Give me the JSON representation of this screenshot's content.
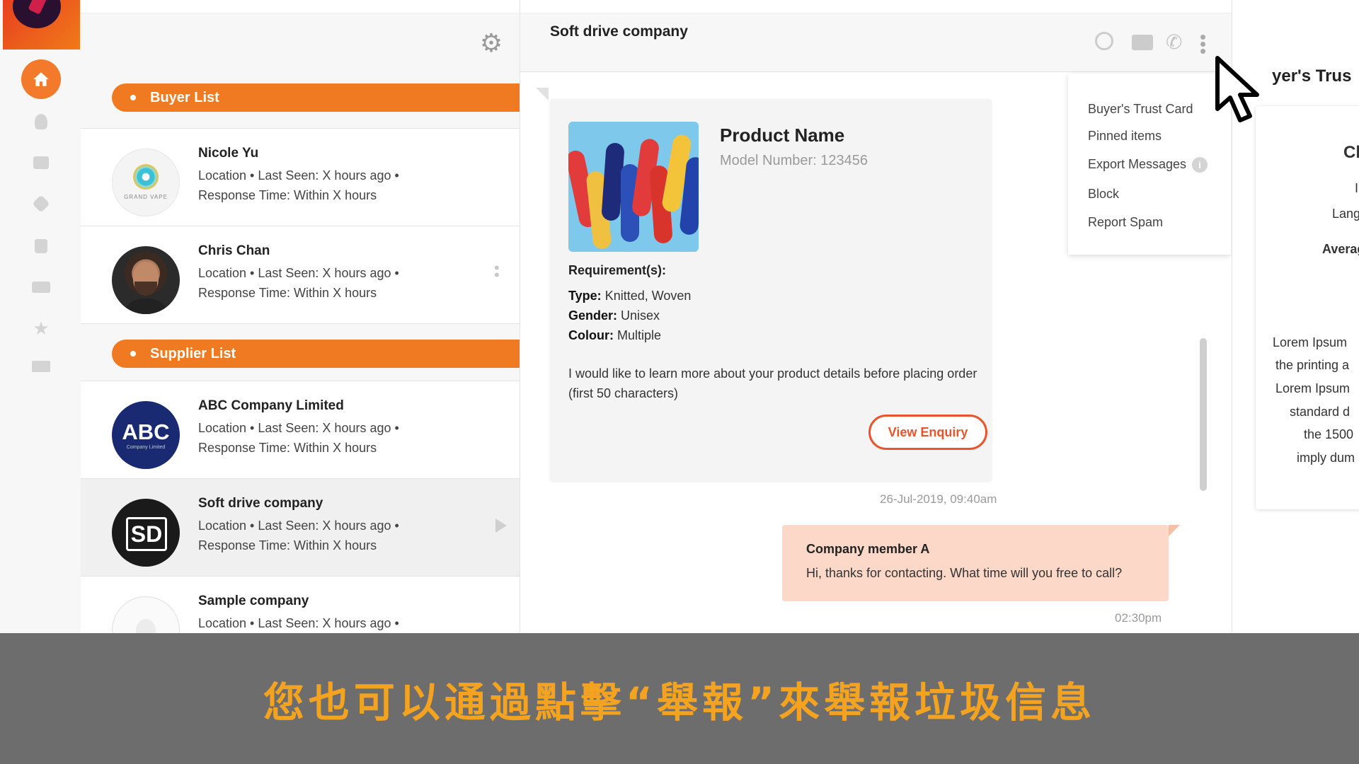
{
  "contacts": {
    "buyer_section": "Buyer List",
    "supplier_section": "Supplier List",
    "buyers": [
      {
        "name": "Nicole Yu",
        "line1": "Location  •  Last Seen: X hours ago  •",
        "line2": "Response Time: Within X hours",
        "avatar_text": "GRAND VAPE"
      },
      {
        "name": "Chris Chan",
        "line1": "Location  •  Last Seen: X hours ago  •",
        "line2": "Response Time: Within X hours"
      }
    ],
    "suppliers": [
      {
        "name": "ABC Company Limited",
        "line1": "Location  •  Last Seen: X hours ago  •",
        "line2": "Response Time: Within X hours",
        "avatar_big": "ABC",
        "avatar_small": "Company Limited"
      },
      {
        "name": "Soft drive company",
        "line1": "Location  •  Last Seen: X hours ago  •",
        "line2": "Response Time: Within X hours",
        "avatar_text": "SD"
      },
      {
        "name": "Sample company",
        "line1": "Location  •  Last Seen: X hours ago  •"
      }
    ]
  },
  "chat": {
    "title": "Soft drive company",
    "enquiry": {
      "product_name": "Product Name",
      "model_number": "Model Number: 123456",
      "requirements_heading": "Requirement(s):",
      "type_label": "Type:",
      "type_value": "Knitted, Woven",
      "gender_label": "Gender:",
      "gender_value": "Unisex",
      "colour_label": "Colour:",
      "colour_value": "Multiple",
      "message": "I would like to learn more about your product details before placing order (first 50 characters)",
      "button": "View Enquiry",
      "timestamp": "26-Jul-2019, 09:40am"
    },
    "reply": {
      "sender": "Company member A",
      "text": "Hi, thanks for contacting. What time will you free to call?",
      "timestamp": "02:30pm"
    }
  },
  "menu": {
    "items": [
      "Buyer's Trust Card",
      "Pinned items",
      "Export Messages",
      "Block",
      "Report Spam"
    ],
    "info": "i"
  },
  "trust_panel": {
    "title": "yer's Trus",
    "texts": [
      "Cl",
      "I",
      "Lang",
      "Averag",
      "Lorem Ipsum",
      "the printing a",
      "Lorem Ipsum",
      "standard d",
      "the 1500",
      "imply dum"
    ]
  },
  "caption": "您也可以通過點擊“舉報”來舉報垃圾信息",
  "colors": {
    "accent_orange": "#f07a22",
    "button_red": "#e9542a",
    "reply_bubble": "#fbd8c7",
    "caption_text": "#f3a320"
  }
}
